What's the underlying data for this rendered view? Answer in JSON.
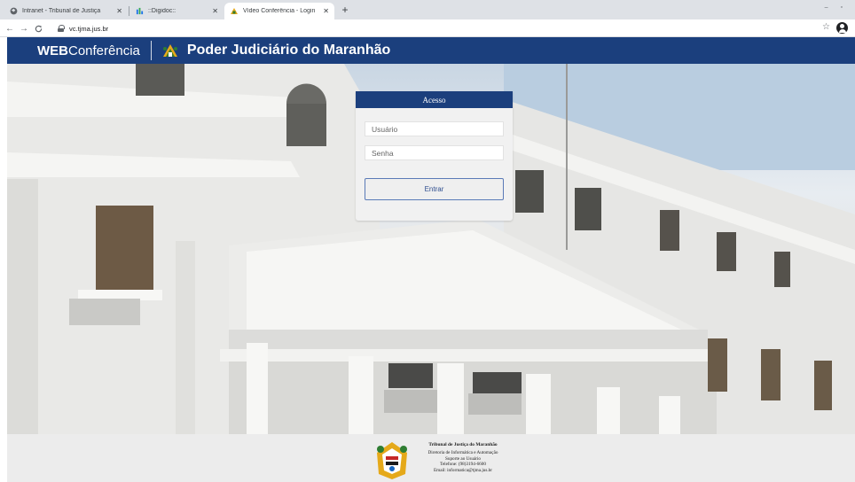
{
  "browser": {
    "tabs": [
      {
        "title": "Intranet - Tribunal de Justiça",
        "active": false
      },
      {
        "title": "::Digidoc::",
        "active": false
      },
      {
        "title": "Vídeo Conferência - Login",
        "active": true
      }
    ],
    "url": "vc.tjma.jus.br"
  },
  "header": {
    "brand_bold": "WEB",
    "brand_rest": "Conferência",
    "court_title": "Poder Judiciário do Maranhão"
  },
  "login": {
    "title": "Acesso",
    "username_placeholder": "Usuário",
    "password_placeholder": "Senha",
    "submit_label": "Entrar"
  },
  "footer": {
    "title": "Tribunal de Justiça do Maranhão",
    "lines": [
      "Diretoria de Informática e Automação",
      "Suporte ao Usuário",
      "Telefone: (98)3194-6600",
      "Email: informatica@tjma.jus.br"
    ]
  },
  "colors": {
    "header_bg": "#1b3f7d",
    "button_border": "#5a7ab7"
  }
}
